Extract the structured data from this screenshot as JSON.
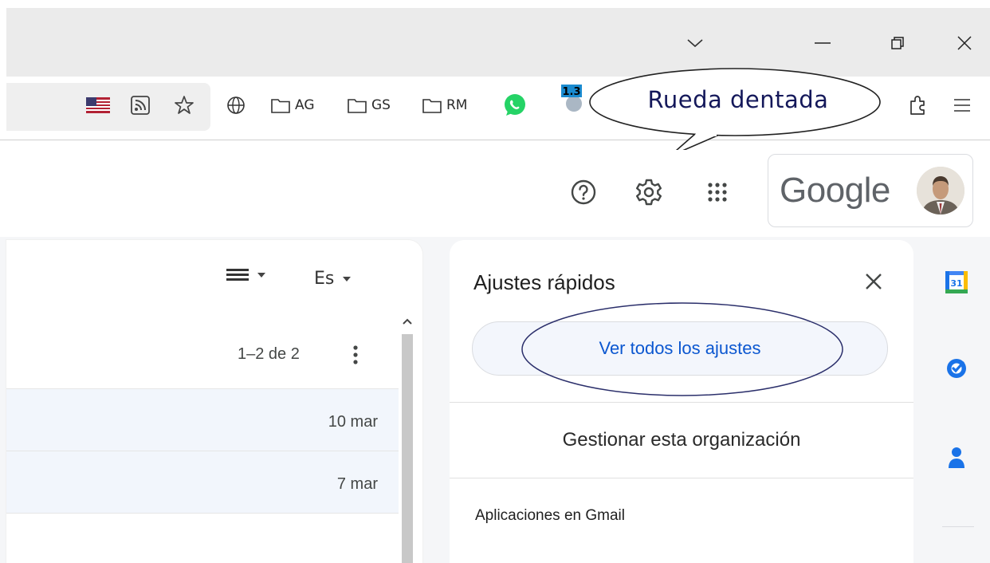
{
  "browser": {
    "window_controls": {
      "tabs_menu_icon": "chevron-down-icon",
      "minimize_icon": "minimize-icon",
      "restore_icon": "restore-icon",
      "close_icon": "close-icon"
    },
    "bookmarks": [
      {
        "label": "AG",
        "icon": "folder-icon"
      },
      {
        "label": "GS",
        "icon": "folder-icon"
      },
      {
        "label": "RM",
        "icon": "folder-icon"
      }
    ],
    "extension_badge": "1.3"
  },
  "callout": {
    "text": "Rueda dentada"
  },
  "header": {
    "wordmark": "Google"
  },
  "mail_list": {
    "pagination": "1–2 de 2",
    "rows": [
      {
        "date": "10 mar"
      },
      {
        "date": "7 mar"
      }
    ],
    "density_toggle_label": "Es"
  },
  "quick_settings": {
    "title": "Ajustes rápidos",
    "see_all_button": "Ver todos los ajustes",
    "manage_org": "Gestionar esta organización",
    "apps_section_title": "Aplicaciones en Gmail"
  },
  "side_rail": {
    "calendar_day": "31"
  },
  "colors": {
    "accent_blue": "#0b57d0",
    "callout_text": "#14185a",
    "whatsapp_green": "#25d366"
  }
}
